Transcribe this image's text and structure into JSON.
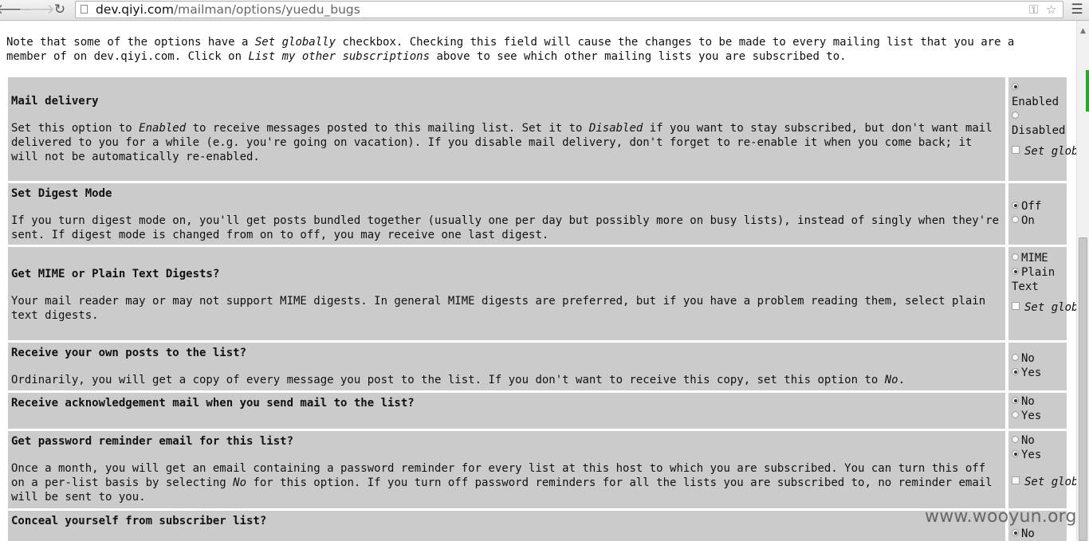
{
  "browser": {
    "back_icon": "arrow-left-icon",
    "forward_icon": "arrow-right-icon",
    "reload_icon": "reload-icon",
    "url_host": "dev.qiyi.com",
    "url_path": "/mailman/options/yuedu_bugs",
    "menu_icon": "hamburger-icon"
  },
  "intro": {
    "p1": "Note that some of the options have a ",
    "em1": "Set globally",
    "p2": " checkbox. Checking this field will cause the changes to be made to every mailing list that you are a member of on dev.qiyi.com. Click on ",
    "em2": "List my other subscriptions",
    "p3": " above to see which other mailing lists you are subscribed to."
  },
  "options": [
    {
      "title": "Mail delivery",
      "desc_parts": [
        "Set this option to ",
        "Enabled",
        " to receive messages posted to this mailing list. Set it to ",
        "Disabled",
        " if you want to stay subscribed, but don't want mail delivered to you for a while (e.g. you're going on vacation). If you disable mail delivery, don't forget to re-enable it when you come back; it will not be automatically re-enabled."
      ],
      "choices": [
        {
          "label": "Enabled",
          "checked": true
        },
        {
          "label": "Disabled",
          "checked": false
        }
      ],
      "set_globally": "Set globally"
    },
    {
      "title": "Set Digest Mode",
      "desc": "If you turn digest mode on, you'll get posts bundled together (usually one per day but possibly more on busy lists), instead of singly when they're sent. If digest mode is changed from on to off, you may receive one last digest.",
      "choices": [
        {
          "label": "Off",
          "checked": true
        },
        {
          "label": "On",
          "checked": false
        }
      ]
    },
    {
      "title": "Get MIME or Plain Text Digests?",
      "desc": "Your mail reader may or may not support MIME digests. In general MIME digests are preferred, but if you have a problem reading them, select plain text digests.",
      "choices": [
        {
          "label": "MIME",
          "checked": false
        },
        {
          "label": "Plain",
          "cont": "Text",
          "checked": true
        }
      ],
      "set_globally": "Set globally"
    },
    {
      "title": "Receive your own posts to the list?",
      "desc_parts": [
        "Ordinarily, you will get a copy of every message you post to the list. If you don't want to receive this copy, set this option to ",
        "No",
        "."
      ],
      "choices": [
        {
          "label": "No",
          "checked": false
        },
        {
          "label": "Yes",
          "checked": true
        }
      ]
    },
    {
      "title": "Receive acknowledgement mail when you send mail to the list?",
      "choices": [
        {
          "label": "No",
          "checked": true
        },
        {
          "label": "Yes",
          "checked": false
        }
      ]
    },
    {
      "title": "Get password reminder email for this list?",
      "desc_parts": [
        "Once a month, you will get an email containing a password reminder for every list at this host to which you are subscribed. You can turn this off on a per-list basis by selecting ",
        "No",
        " for this option. If you turn off password reminders for all the lists you are subscribed to, no reminder email will be sent to you."
      ],
      "choices": [
        {
          "label": "No",
          "checked": false
        },
        {
          "label": "Yes",
          "checked": true
        }
      ],
      "set_globally": "Set globally"
    },
    {
      "title": "Conceal yourself from subscriber list?",
      "choices": [
        {
          "label": "No",
          "checked": true
        }
      ]
    }
  ],
  "watermark": "www.wooyun.org"
}
